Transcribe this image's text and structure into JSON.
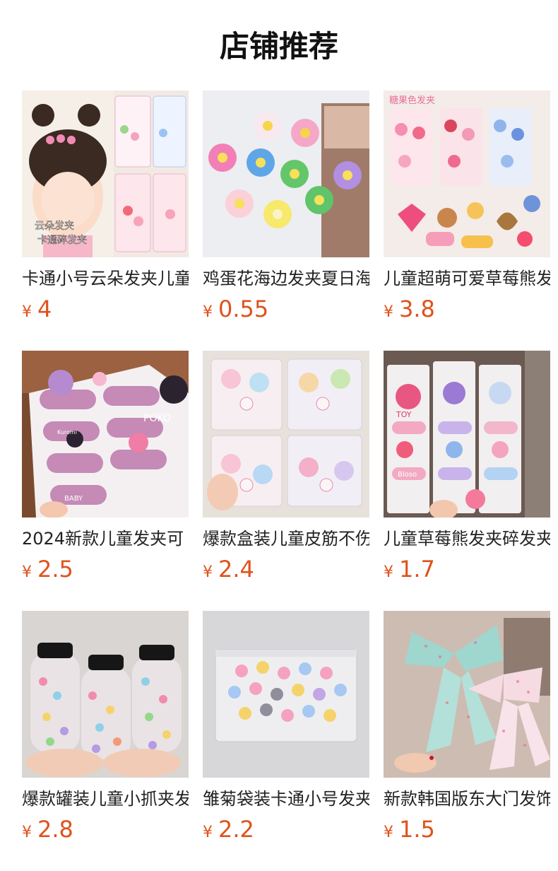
{
  "header": {
    "title": "店铺推荐"
  },
  "products": [
    {
      "name": "卡通小号云朵发夹儿童",
      "currency": "¥",
      "price": "4",
      "image_text": [
        "云朵发夹",
        "卡通碎发夹"
      ]
    },
    {
      "name": "鸡蛋花海边发夹夏日海",
      "currency": "¥",
      "price": "0.55"
    },
    {
      "name": "儿童超萌可爱草莓熊发",
      "currency": "¥",
      "price": "3.8",
      "image_text": [
        "糖果色发夹"
      ]
    },
    {
      "name": "2024新款儿童发夹可",
      "currency": "¥",
      "price": "2.5",
      "image_text": [
        "POKO",
        "Kuromi",
        "BABY"
      ]
    },
    {
      "name": "爆款盒装儿童皮筋不伤",
      "currency": "¥",
      "price": "2.4"
    },
    {
      "name": "儿童草莓熊发夹碎发夹",
      "currency": "¥",
      "price": "1.7",
      "image_text": [
        "TOY",
        "Bloso"
      ]
    },
    {
      "name": "爆款罐装儿童小抓夹发",
      "currency": "¥",
      "price": "2.8"
    },
    {
      "name": "雏菊袋装卡通小号发夹",
      "currency": "¥",
      "price": "2.2"
    },
    {
      "name": "新款韩国版东大门发饰",
      "currency": "¥",
      "price": "1.5"
    }
  ]
}
